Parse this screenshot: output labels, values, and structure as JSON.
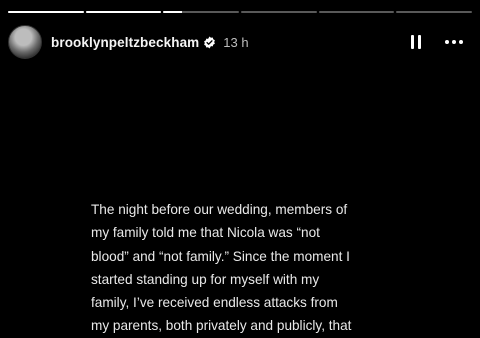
{
  "story": {
    "segments": [
      {
        "progress": 1
      },
      {
        "progress": 1
      },
      {
        "progress": 0.25
      },
      {
        "progress": 0
      },
      {
        "progress": 0
      },
      {
        "progress": 0
      }
    ],
    "username": "brooklynpeltzbeckham",
    "verified": true,
    "time": "13 h",
    "controls": {
      "pause_icon": "pause-icon",
      "more_icon": "more-options-icon"
    },
    "text": "The night before our wedding, members of\nmy family told me that Nicola was “not\nblood” and “not family.” Since the moment I\nstarted standing up for myself with my\nfamily, I’ve received endless attacks from\nmy parents, both privately and publicly, that"
  },
  "colors": {
    "background": "#000000",
    "text": "#e9e9e9",
    "verified_badge": "#ffffff",
    "progress_inactive": "rgba(255,255,255,0.35)"
  }
}
